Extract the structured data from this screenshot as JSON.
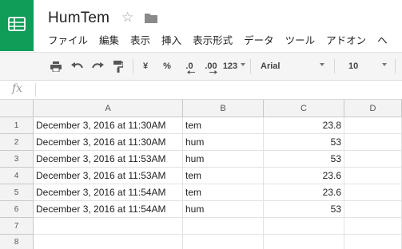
{
  "document": {
    "title": "HumTem"
  },
  "menu": [
    "ファイル",
    "編集",
    "表示",
    "挿入",
    "表示形式",
    "データ",
    "ツール",
    "アドオン",
    "ヘ"
  ],
  "toolbar": {
    "currency_label": "¥",
    "percent_label": "%",
    "decrease_decimal_label": ".0",
    "increase_decimal_label": ".00",
    "number_format_label": "123",
    "font_family": "Arial",
    "font_size": "10"
  },
  "formula_bar": {
    "fx_label": "fx",
    "value": ""
  },
  "columns": [
    "A",
    "B",
    "C",
    "D"
  ],
  "rows": [
    {
      "num": "1",
      "a": "December 3, 2016 at 11:30AM",
      "b": "tem",
      "c": "23.8",
      "d": ""
    },
    {
      "num": "2",
      "a": "December 3, 2016 at 11:30AM",
      "b": "hum",
      "c": "53",
      "d": ""
    },
    {
      "num": "3",
      "a": "December 3, 2016 at 11:53AM",
      "b": "hum",
      "c": "53",
      "d": ""
    },
    {
      "num": "4",
      "a": "December 3, 2016 at 11:53AM",
      "b": "tem",
      "c": "23.6",
      "d": ""
    },
    {
      "num": "5",
      "a": "December 3, 2016 at 11:54AM",
      "b": "tem",
      "c": "23.6",
      "d": ""
    },
    {
      "num": "6",
      "a": "December 3, 2016 at 11:54AM",
      "b": "hum",
      "c": "53",
      "d": ""
    },
    {
      "num": "7",
      "a": "",
      "b": "",
      "c": "",
      "d": ""
    },
    {
      "num": "8",
      "a": "",
      "b": "",
      "c": "",
      "d": ""
    }
  ],
  "colors": {
    "brand_green": "#0f9d58",
    "header_gray": "#f3f3f3",
    "toolbar_gray": "#f5f5f5"
  }
}
